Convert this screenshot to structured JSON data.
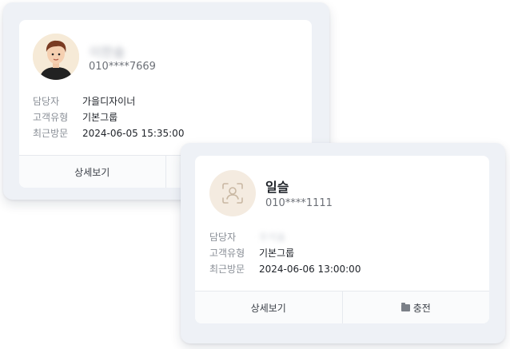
{
  "cards": [
    {
      "name": "이한솔",
      "phone": "010****7669",
      "rows": [
        {
          "label": "담당자",
          "value": "가을디자이너"
        },
        {
          "label": "고객유형",
          "value": "기본그룹"
        },
        {
          "label": "최근방문",
          "value": "2024-06-05 15:35:00"
        }
      ],
      "actions": {
        "detail": "상세보기"
      }
    },
    {
      "name": "일슬",
      "phone": "010****1111",
      "rows": [
        {
          "label": "담당자",
          "value": "우석솔"
        },
        {
          "label": "고객유형",
          "value": "기본그룹"
        },
        {
          "label": "최근방문",
          "value": "2024-06-06 13:00:00"
        }
      ],
      "actions": {
        "detail": "상세보기",
        "charge": "충전"
      }
    }
  ],
  "icons": {
    "avatar_placeholder": "user-scan-icon",
    "charge": "wallet-icon"
  },
  "colors": {
    "avatar_bg": "#f6ead7",
    "placeholder_bg": "#f4ebe0",
    "text": "#1f2329",
    "muted": "#8a8f97"
  }
}
